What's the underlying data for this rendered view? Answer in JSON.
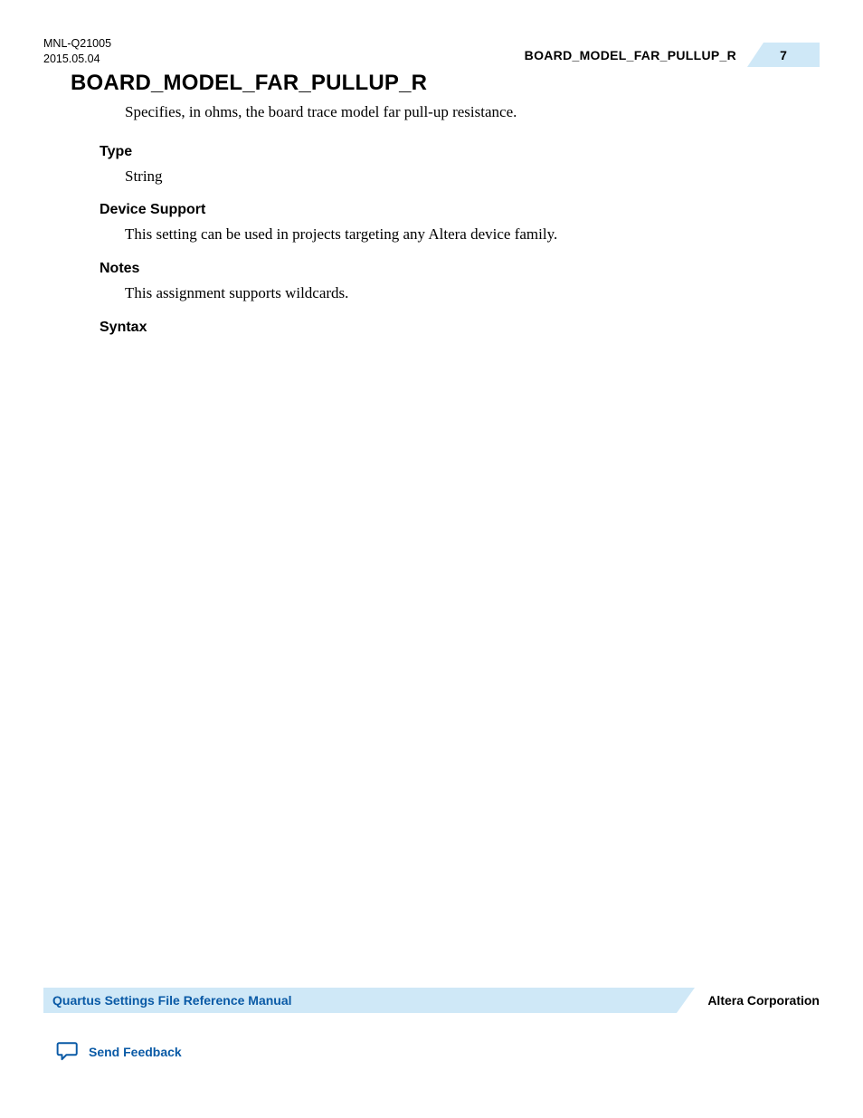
{
  "header": {
    "doc_id": "MNL-Q21005",
    "date": "2015.05.04",
    "running_title": "BOARD_MODEL_FAR_PULLUP_R",
    "page_number": "7"
  },
  "body": {
    "title": "BOARD_MODEL_FAR_PULLUP_R",
    "intro": "Specifies, in ohms, the board trace model far pull-up resistance.",
    "sections": [
      {
        "heading": "Type",
        "body": "String"
      },
      {
        "heading": "Device Support",
        "body": "This setting can be used in projects targeting any Altera device family."
      },
      {
        "heading": "Notes",
        "body": "This assignment supports wildcards."
      },
      {
        "heading": "Syntax",
        "body": ""
      }
    ]
  },
  "footer": {
    "manual_title": "Quartus Settings File Reference Manual",
    "corp": "Altera Corporation",
    "feedback_label": "Send Feedback"
  }
}
